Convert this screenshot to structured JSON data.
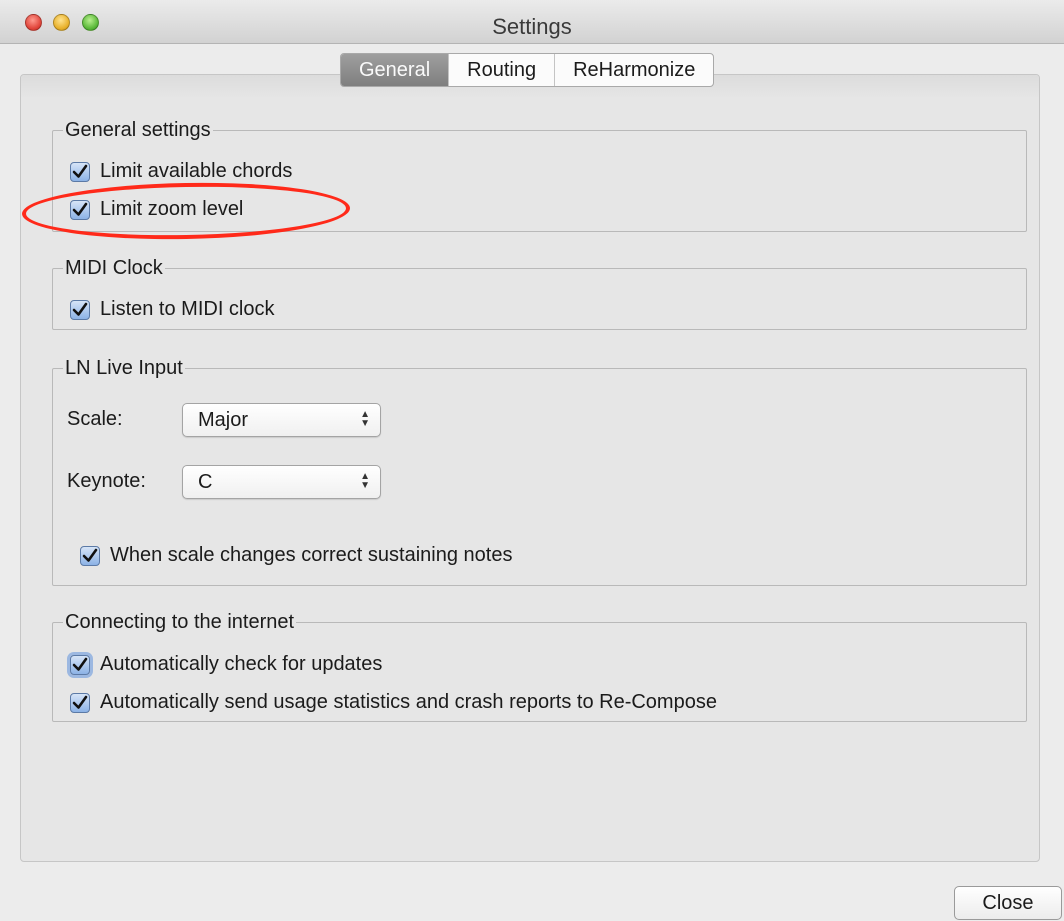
{
  "window": {
    "title": "Settings"
  },
  "tabs": [
    {
      "label": "General",
      "selected": true
    },
    {
      "label": "Routing",
      "selected": false
    },
    {
      "label": "ReHarmonize",
      "selected": false
    }
  ],
  "general_settings": {
    "title": "General settings",
    "limit_chords": {
      "label": "Limit available chords",
      "checked": true
    },
    "limit_zoom": {
      "label": "Limit zoom level",
      "checked": true
    }
  },
  "midi_clock": {
    "title": "MIDI Clock",
    "listen": {
      "label": "Listen to MIDI clock",
      "checked": true
    }
  },
  "ln_live_input": {
    "title": "LN Live Input",
    "scale_label": "Scale:",
    "scale_value": "Major",
    "keynote_label": "Keynote:",
    "keynote_value": "C",
    "correct_notes": {
      "label": "When scale changes correct sustaining notes",
      "checked": true
    }
  },
  "internet": {
    "title": "Connecting to the internet",
    "check_updates": {
      "label": "Automatically check for updates",
      "checked": true
    },
    "send_stats": {
      "label": "Automatically send usage statistics and crash reports to Re-Compose",
      "checked": true
    }
  },
  "footer": {
    "close_label": "Close"
  },
  "colors": {
    "annotation_red": "#ff2a1a",
    "checkbox_blue": "#8cb2e6"
  }
}
